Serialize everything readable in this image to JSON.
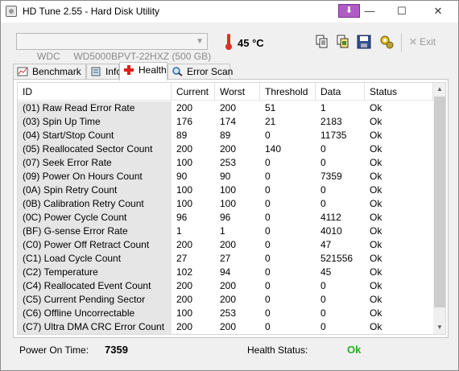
{
  "window": {
    "title": "HD Tune 2.55 - Hard Disk Utility",
    "special_button_glyph": "⬇",
    "minimize_glyph": "—",
    "maximize_glyph": "☐",
    "close_glyph": "✕"
  },
  "toolbar": {
    "drive": "WDC     WD5000BPVT-22HXZ (500 GB)",
    "temperature": "45 °C",
    "exit_label": "Exit",
    "buttons": [
      "copy-text-icon",
      "copy-screenshot-icon",
      "save-icon",
      "options-icon"
    ]
  },
  "tabs": [
    {
      "label": "Benchmark",
      "icon": "benchmark-icon"
    },
    {
      "label": "Info",
      "icon": "info-icon"
    },
    {
      "label": "Health",
      "icon": "health-cross-icon",
      "active": true
    },
    {
      "label": "Error Scan",
      "icon": "magnifier-icon"
    }
  ],
  "table": {
    "headers": [
      "ID",
      "Current",
      "Worst",
      "Threshold",
      "Data",
      "Status"
    ],
    "rows": [
      [
        "(01) Raw Read Error Rate",
        "200",
        "200",
        "51",
        "1",
        "Ok"
      ],
      [
        "(03) Spin Up Time",
        "176",
        "174",
        "21",
        "2183",
        "Ok"
      ],
      [
        "(04) Start/Stop Count",
        "89",
        "89",
        "0",
        "11735",
        "Ok"
      ],
      [
        "(05) Reallocated Sector Count",
        "200",
        "200",
        "140",
        "0",
        "Ok"
      ],
      [
        "(07) Seek Error Rate",
        "100",
        "253",
        "0",
        "0",
        "Ok"
      ],
      [
        "(09) Power On Hours Count",
        "90",
        "90",
        "0",
        "7359",
        "Ok"
      ],
      [
        "(0A) Spin Retry Count",
        "100",
        "100",
        "0",
        "0",
        "Ok"
      ],
      [
        "(0B) Calibration Retry Count",
        "100",
        "100",
        "0",
        "0",
        "Ok"
      ],
      [
        "(0C) Power Cycle Count",
        "96",
        "96",
        "0",
        "4112",
        "Ok"
      ],
      [
        "(BF) G-sense Error Rate",
        "1",
        "1",
        "0",
        "4010",
        "Ok"
      ],
      [
        "(C0) Power Off Retract Count",
        "200",
        "200",
        "0",
        "47",
        "Ok"
      ],
      [
        "(C1) Load Cycle Count",
        "27",
        "27",
        "0",
        "521556",
        "Ok"
      ],
      [
        "(C2) Temperature",
        "102",
        "94",
        "0",
        "45",
        "Ok"
      ],
      [
        "(C4) Reallocated Event Count",
        "200",
        "200",
        "0",
        "0",
        "Ok"
      ],
      [
        "(C5) Current Pending Sector",
        "200",
        "200",
        "0",
        "0",
        "Ok"
      ],
      [
        "(C6) Offline Uncorrectable",
        "100",
        "253",
        "0",
        "0",
        "Ok"
      ],
      [
        "(C7) Ultra DMA CRC Error Count",
        "200",
        "200",
        "0",
        "0",
        "Ok"
      ]
    ]
  },
  "footer": {
    "power_on_label": "Power On Time:",
    "power_on_value": "7359",
    "health_label": "Health Status:",
    "health_value": "Ok"
  },
  "colors": {
    "health_ok": "#22b022",
    "thermometer": "#e03020",
    "id_column_bg": "#e6e6e6"
  }
}
